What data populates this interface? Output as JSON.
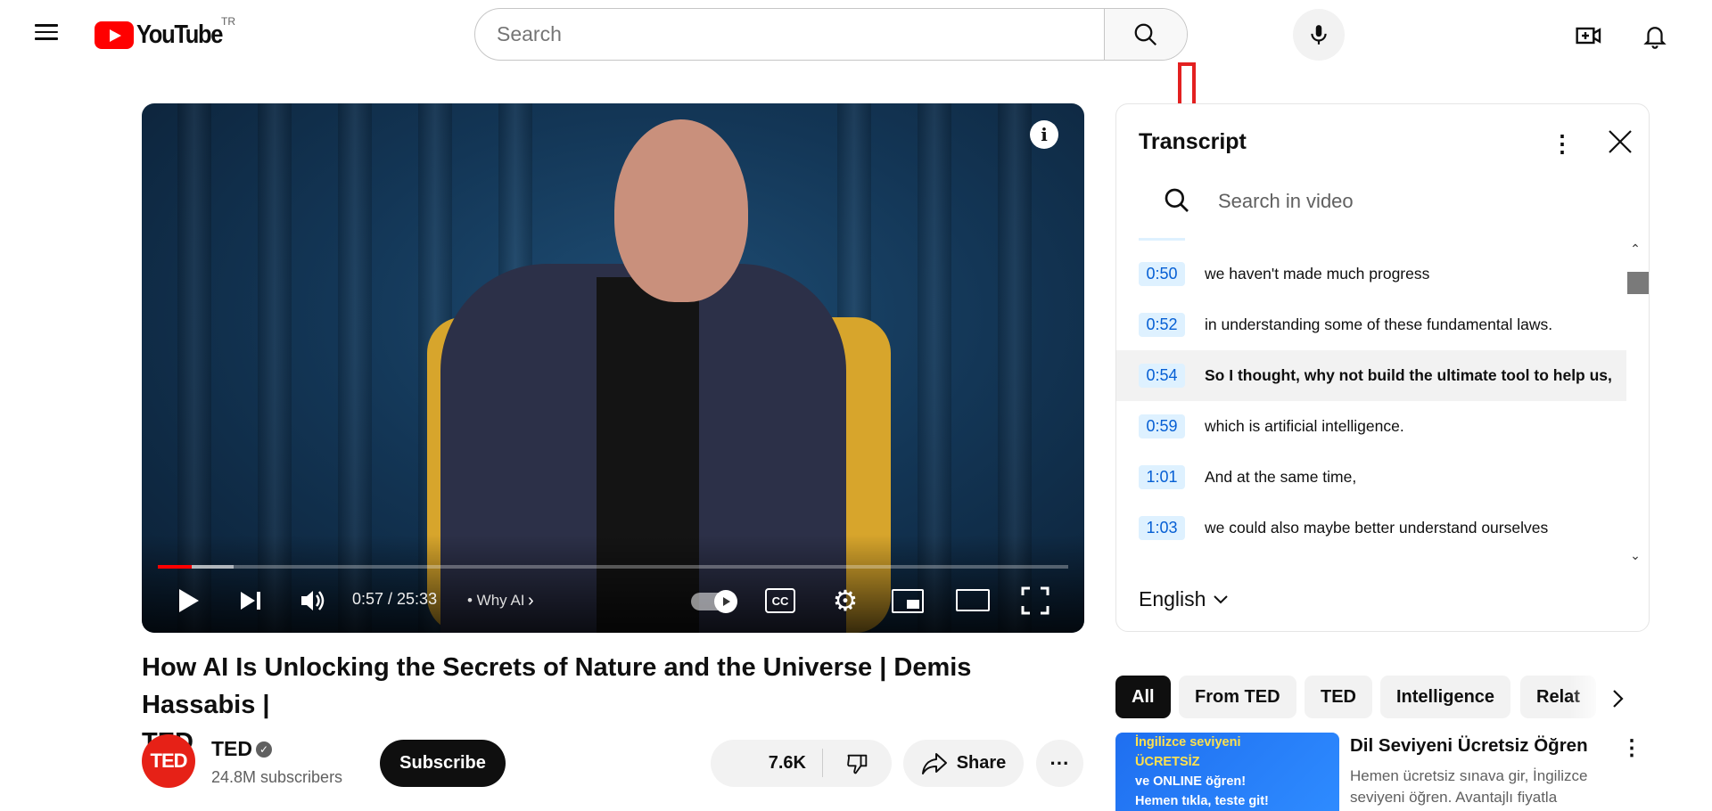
{
  "header": {
    "logo_text": "YouTube",
    "country_code": "TR",
    "search_placeholder": "Search"
  },
  "player": {
    "current_time": "0:57",
    "duration": "25:33",
    "time_display": "0:57 / 25:33",
    "chapter": "• Why AI",
    "progress_played_fraction": 0.037,
    "progress_buffered_fraction": 0.083
  },
  "video": {
    "title_line1": "How AI Is Unlocking the Secrets of Nature and the Universe | Demis Hassabis |",
    "title_line2": "TED",
    "channel_name": "TED",
    "channel_avatar_text": "TED",
    "subscribers": "24.8M subscribers",
    "subscribe_label": "Subscribe",
    "likes": "7.6K",
    "share_label": "Share"
  },
  "transcript": {
    "title": "Transcript",
    "search_placeholder": "Search in video",
    "language": "English",
    "segments": [
      {
        "time": "0:50",
        "text": "we haven't made much progress",
        "active": false
      },
      {
        "time": "0:52",
        "text": "in understanding some of these fundamental laws.",
        "active": false
      },
      {
        "time": "0:54",
        "text": "So I thought, why not build the ultimate tool to help us,",
        "active": true
      },
      {
        "time": "0:59",
        "text": "which is artificial intelligence.",
        "active": false
      },
      {
        "time": "1:01",
        "text": "And at the same time,",
        "active": false
      },
      {
        "time": "1:03",
        "text": "we could also maybe better understand ourselves",
        "active": false
      }
    ]
  },
  "chips": [
    "All",
    "From TED",
    "TED",
    "Intelligence",
    "Relat"
  ],
  "ad": {
    "thumb_lines": [
      "İngilizce seviyeni",
      "ÜCRETSİZ",
      "ve ONLINE öğren!",
      "Hemen tıkla, teste git!"
    ],
    "thumb_line_colors": [
      "#ffe14d",
      "#ffe14d",
      "#ffffff",
      "#ffffff"
    ],
    "title": "Dil Seviyeni Ücretsiz Öğren",
    "description": "Hemen ücretsiz sınava gir, İngilizce seviyeni öğren. Avantajlı fiyatla"
  },
  "colors": {
    "brand_red": "#ff0000",
    "annotation_red": "#e32020",
    "timestamp_bg": "#def1ff",
    "timestamp_text": "#065fd4"
  },
  "icons": [
    "menu-icon",
    "search-icon",
    "mic-icon",
    "create-icon",
    "bell-icon",
    "info-icon",
    "play-icon",
    "next-icon",
    "volume-icon",
    "autoplay-toggle",
    "cc-icon",
    "settings-icon",
    "miniplayer-icon",
    "theater-icon",
    "fullscreen-icon",
    "like-icon",
    "dislike-icon",
    "share-icon",
    "more-icon",
    "close-icon",
    "chevron-up-icon",
    "chevron-down-icon",
    "chevron-right-icon",
    "down-arrow-annotation"
  ]
}
